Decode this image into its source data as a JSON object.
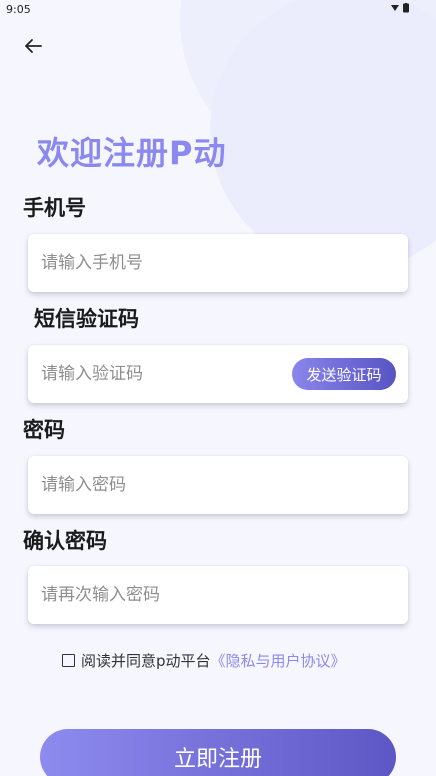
{
  "status_bar": {
    "time": "9:05",
    "icons": "▾ ▮"
  },
  "icons": {
    "back": "back-arrow-icon"
  },
  "title": "欢迎注册P动",
  "phone": {
    "label": "手机号",
    "placeholder": "请输入手机号",
    "value": ""
  },
  "sms": {
    "label": "短信验证码",
    "placeholder": "请输入验证码",
    "value": "",
    "send_button": "发送验证码"
  },
  "password": {
    "label": "密码",
    "placeholder": "请输入密码",
    "value": ""
  },
  "confirm_password": {
    "label": "确认密码",
    "placeholder": "请再次输入密码",
    "value": ""
  },
  "agreement": {
    "text": "阅读并同意p动平台",
    "link": "《隐私与用户协议》",
    "checked": false
  },
  "submit": {
    "label": "立即注册"
  },
  "colors": {
    "accent": "#8b89f0",
    "button_start": "#8e8bef",
    "button_end": "#5d57c5"
  }
}
